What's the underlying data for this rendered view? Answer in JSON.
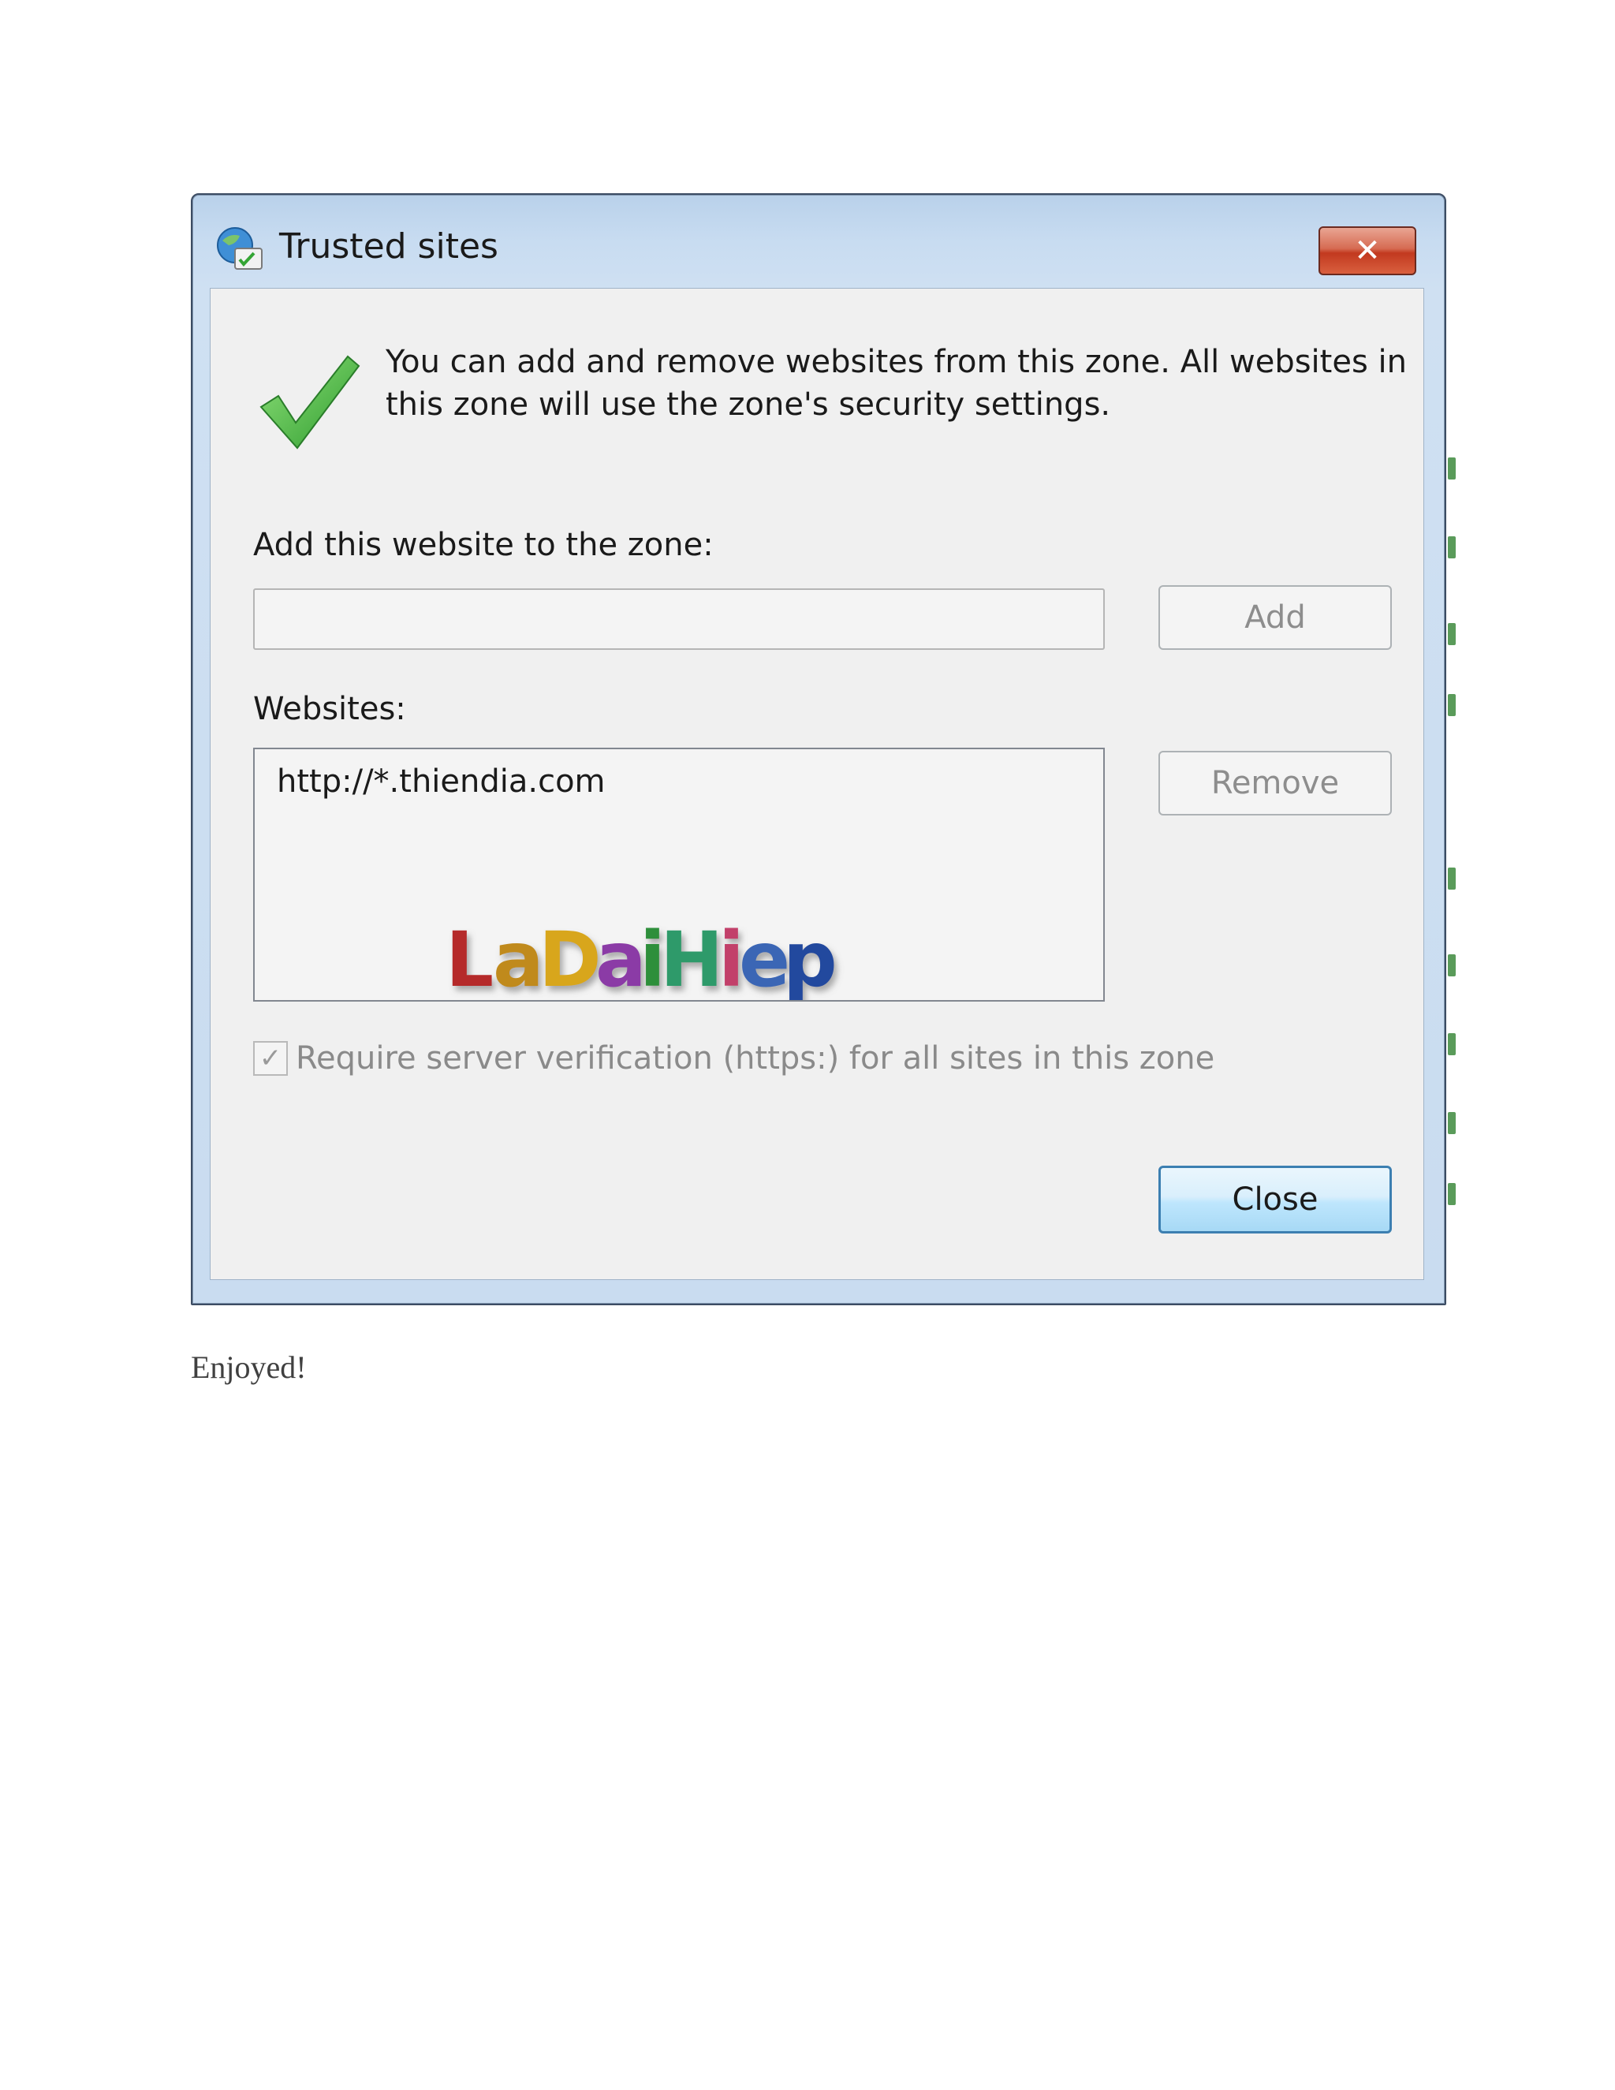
{
  "window": {
    "title": "Trusted sites",
    "close_glyph": "✕"
  },
  "intro": {
    "text": "You can add and remove websites from this zone. All websites in this zone will use the zone's security settings."
  },
  "add": {
    "label": "Add this website to the zone:",
    "value": "",
    "button_label": "Add"
  },
  "websites": {
    "label": "Websites:",
    "items": [
      "http://*.thiendia.com"
    ],
    "remove_label": "Remove",
    "watermark_text": "LaDaiHiep"
  },
  "verify": {
    "checked": true,
    "label": "Require server verification (https:) for all sites in this zone"
  },
  "footer": {
    "close_label": "Close"
  },
  "caption": "Enjoyed!",
  "icons": {
    "title": "trusted-sites-icon",
    "check": "checkmark-icon",
    "close": "close-icon"
  },
  "colors": {
    "check_green": "#3fae3f",
    "close_red": "#c2391f",
    "focus_blue": "#3c7fb1"
  }
}
